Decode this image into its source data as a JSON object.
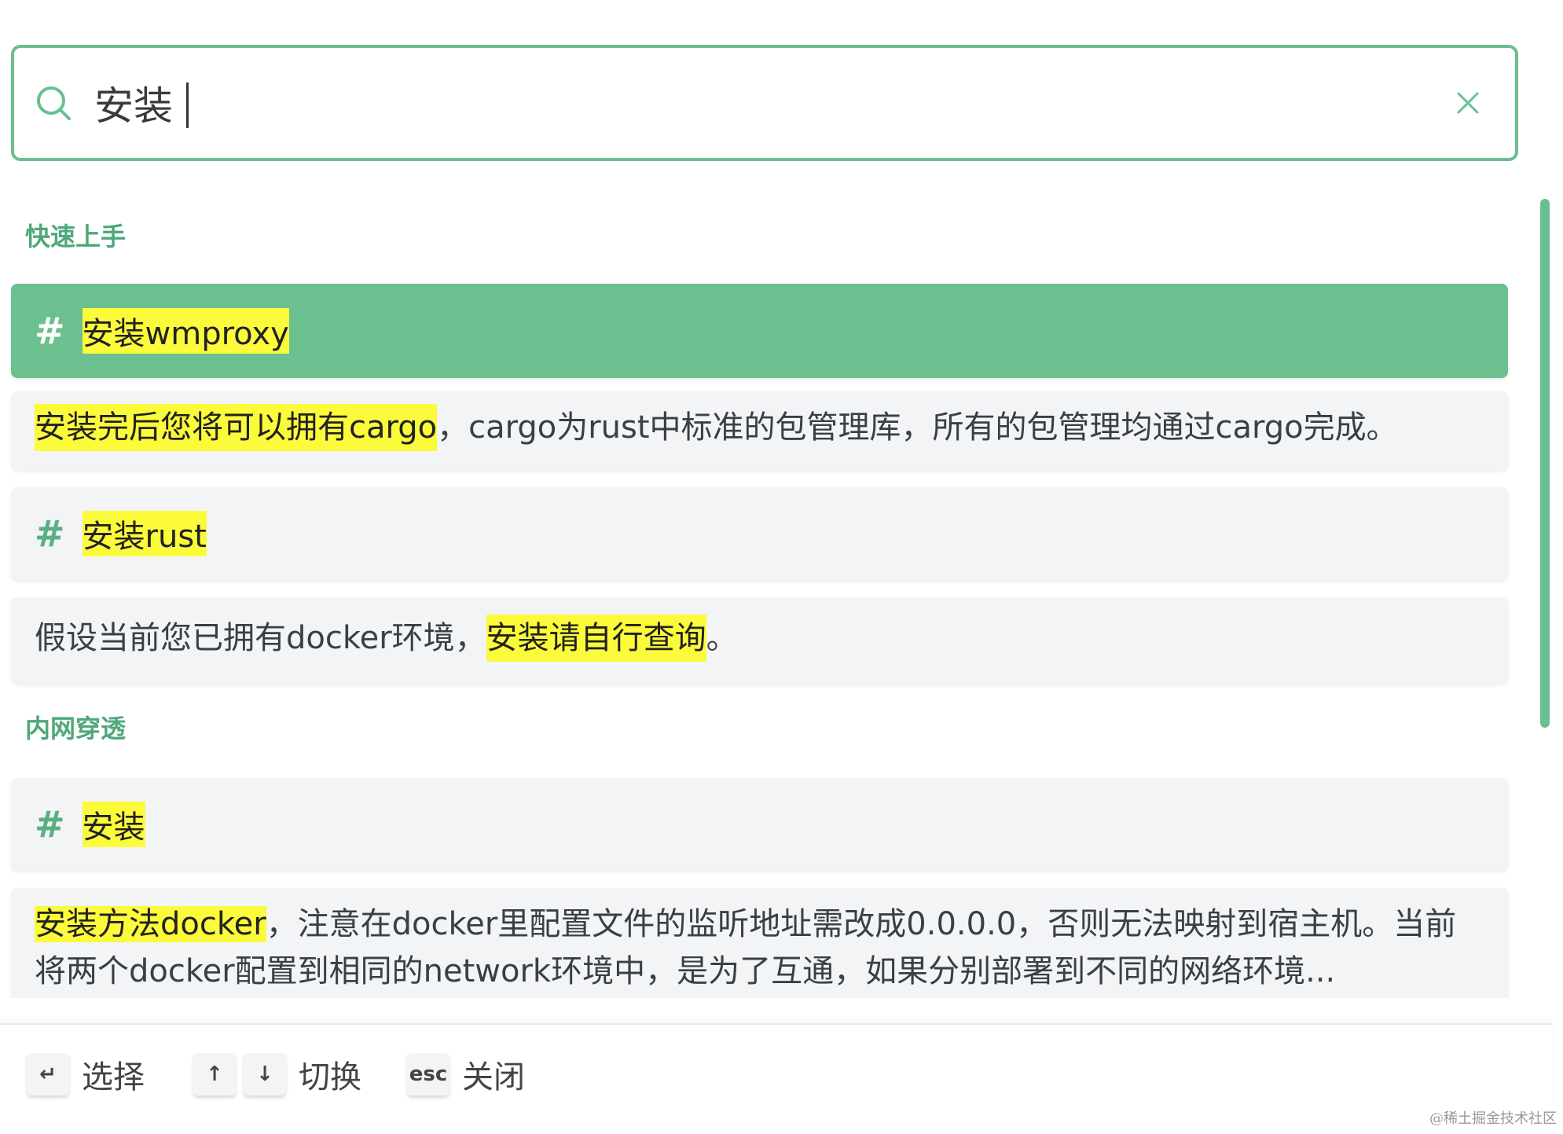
{
  "search": {
    "value": "安装",
    "placeholder": "",
    "clear_icon": "close-icon",
    "search_icon": "search-icon"
  },
  "groups": [
    {
      "title": "快速上手",
      "hits": [
        {
          "type": "heading",
          "prefix": "#",
          "highlight": "安装wmproxy",
          "rest": "",
          "active": true
        },
        {
          "type": "text",
          "pre": "",
          "highlight": "安装完后您将可以拥有cargo",
          "rest": "，cargo为rust中标准的包管理库，所有的包管理均通过cargo完成。"
        },
        {
          "type": "heading",
          "prefix": "#",
          "highlight": "安装rust",
          "rest": ""
        },
        {
          "type": "text",
          "pre": "假设当前您已拥有docker环境，",
          "highlight": "安装请自行查询",
          "rest": "。"
        }
      ]
    },
    {
      "title": "内网穿透",
      "hits": [
        {
          "type": "heading",
          "prefix": "#",
          "highlight": "安装",
          "rest": ""
        },
        {
          "type": "text",
          "pre": "",
          "highlight": "安装方法docker",
          "rest": "，注意在docker里配置文件的监听地址需改成0.0.0.0，否则无法映射到宿主机。当前将两个docker配置到相同的network环境中，是为了互通，如果分别部署到不同的网络环境..."
        }
      ]
    }
  ],
  "footer": {
    "select_key": "↵",
    "select_label": "选择",
    "up_key": "↑",
    "down_key": "↓",
    "switch_label": "切换",
    "esc_key": "esc",
    "close_label": "关闭"
  },
  "watermark": "@稀土掘金技术社区",
  "colors": {
    "accent": "#6abf90",
    "highlight": "#fbfb3c",
    "active_bg": "#6cbf8e",
    "group_title": "#4ea87a"
  }
}
